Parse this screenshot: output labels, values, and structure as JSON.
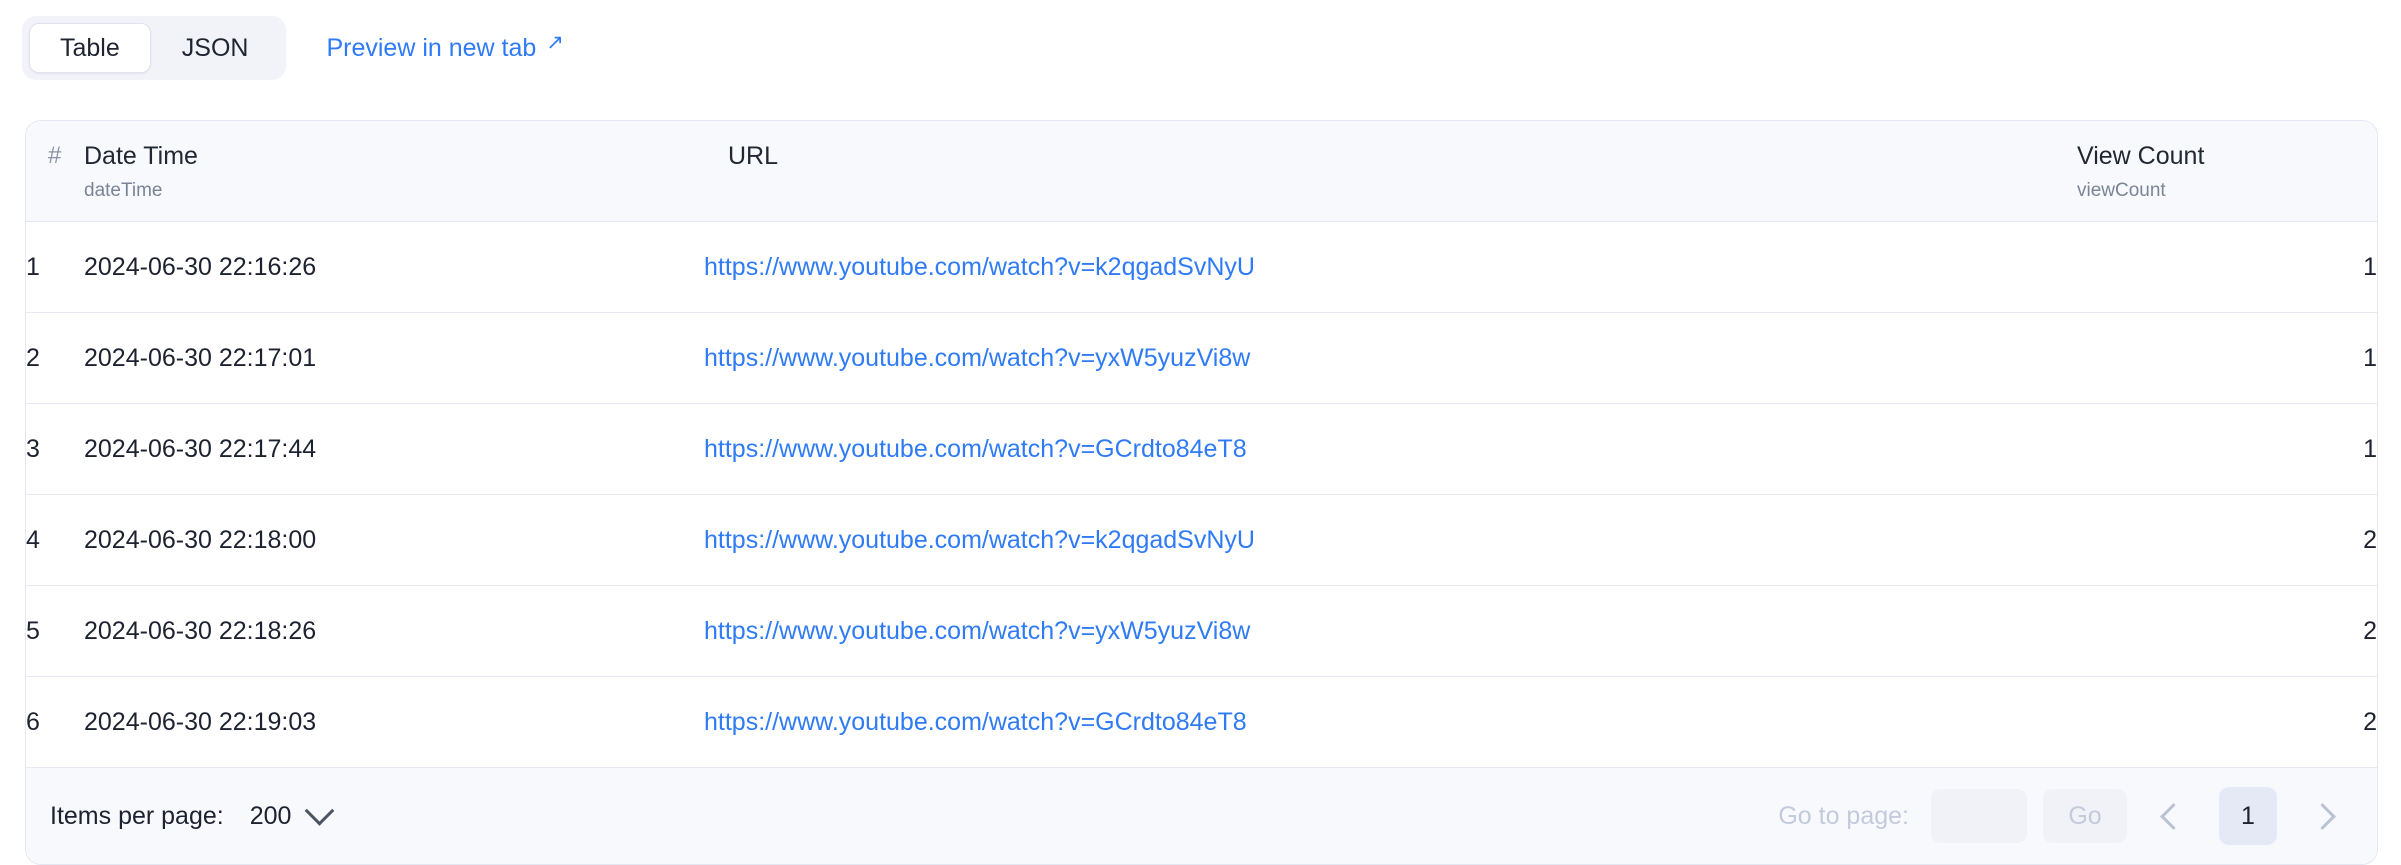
{
  "toolbar": {
    "view_tabs": [
      {
        "label": "Table",
        "active": true
      },
      {
        "label": "JSON",
        "active": false
      }
    ],
    "preview_link": "Preview in new tab",
    "preview_icon": "external-link-arrow-icon"
  },
  "table": {
    "columns": [
      {
        "title": "#",
        "field": ""
      },
      {
        "title": "Date Time",
        "field": "dateTime"
      },
      {
        "title": "URL",
        "field": ""
      },
      {
        "title": "View Count",
        "field": "viewCount"
      }
    ],
    "rows": [
      {
        "index": "1",
        "dateTime": "2024-06-30 22:16:26",
        "url": "https://www.youtube.com/watch?v=k2qgadSvNyU",
        "viewCount": "1"
      },
      {
        "index": "2",
        "dateTime": "2024-06-30 22:17:01",
        "url": "https://www.youtube.com/watch?v=yxW5yuzVi8w",
        "viewCount": "1"
      },
      {
        "index": "3",
        "dateTime": "2024-06-30 22:17:44",
        "url": "https://www.youtube.com/watch?v=GCrdto84eT8",
        "viewCount": "1"
      },
      {
        "index": "4",
        "dateTime": "2024-06-30 22:18:00",
        "url": "https://www.youtube.com/watch?v=k2qgadSvNyU",
        "viewCount": "2"
      },
      {
        "index": "5",
        "dateTime": "2024-06-30 22:18:26",
        "url": "https://www.youtube.com/watch?v=yxW5yuzVi8w",
        "viewCount": "2"
      },
      {
        "index": "6",
        "dateTime": "2024-06-30 22:19:03",
        "url": "https://www.youtube.com/watch?v=GCrdto84eT8",
        "viewCount": "2"
      }
    ]
  },
  "footer": {
    "items_per_page_label": "Items per page:",
    "items_per_page_value": "200",
    "items_per_page_icon": "chevron-down-icon",
    "goto_label": "Go to page:",
    "goto_value": "",
    "goto_placeholder": "",
    "go_button": "Go",
    "prev_icon": "chevron-left-icon",
    "next_icon": "chevron-right-icon",
    "current_page": "1"
  },
  "colors": {
    "link": "#2f7bf6",
    "header_bg": "#f7f9fc",
    "border": "#e3e7f2",
    "page_active_bg": "#e5e9f6",
    "muted": "#c3cadb"
  }
}
